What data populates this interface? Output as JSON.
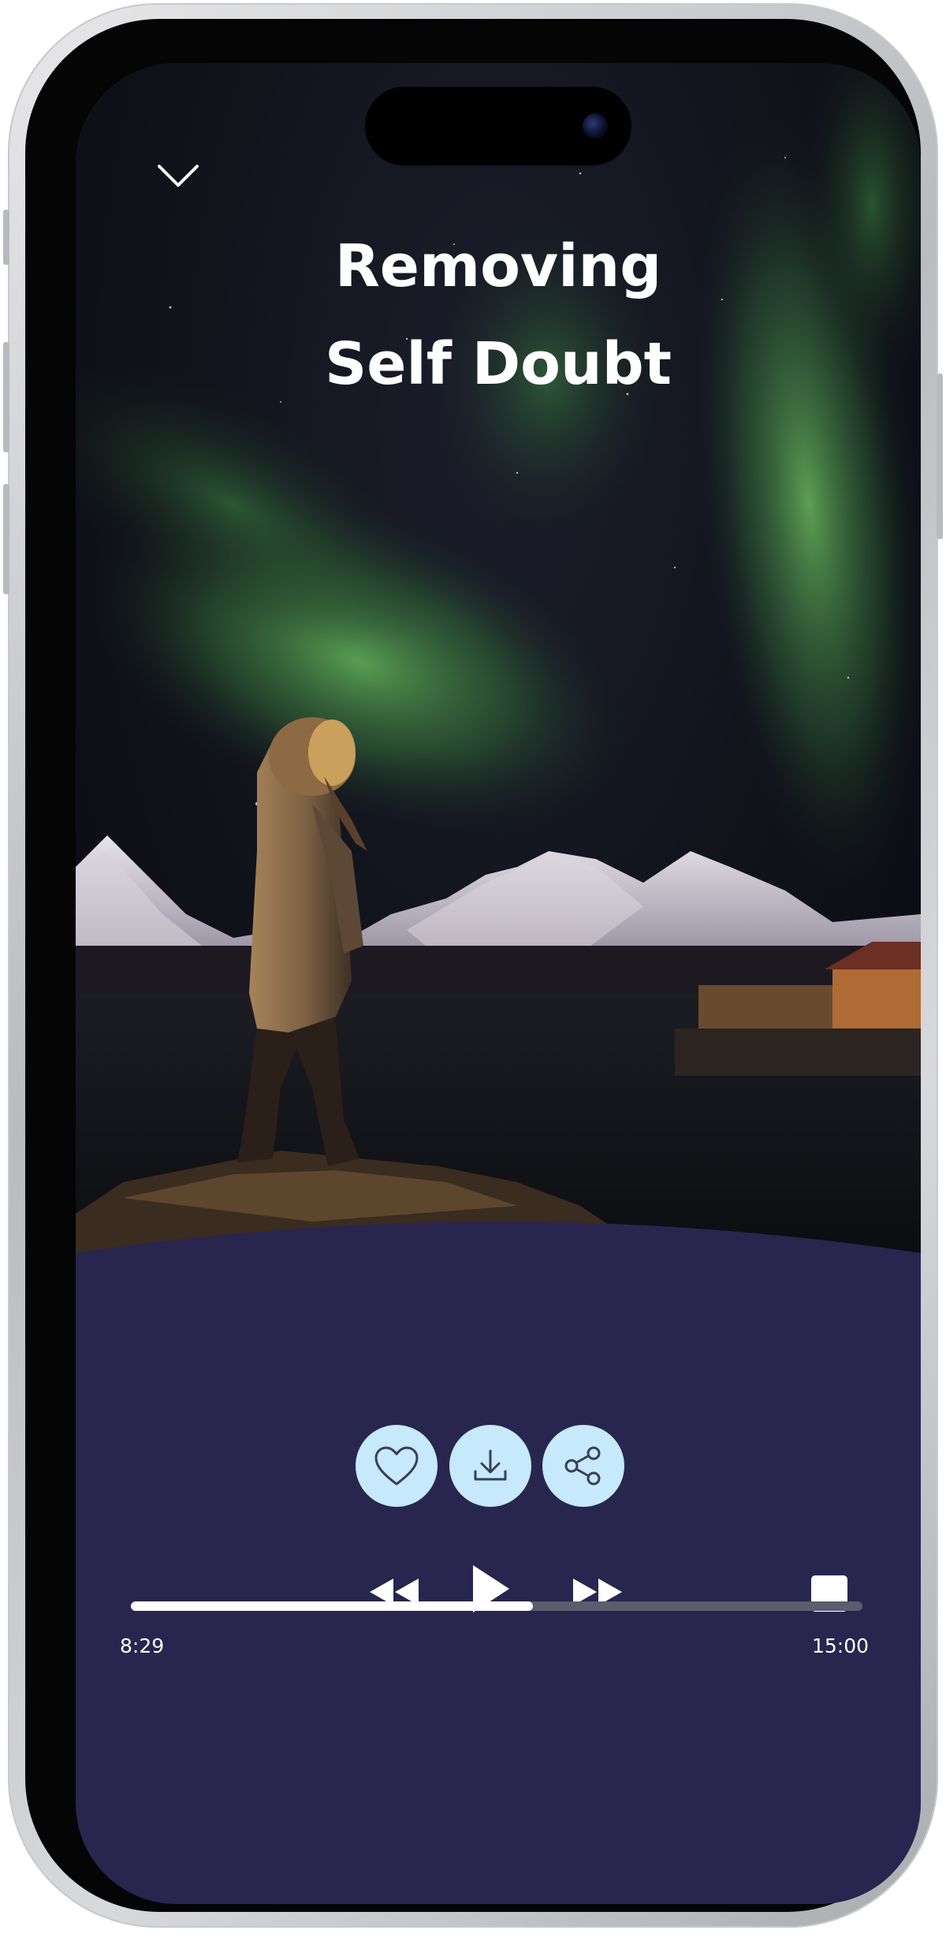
{
  "track": {
    "title": "Removing\nSelf Doubt",
    "elapsed": "8:29",
    "duration": "15:00",
    "progress": 0.55
  },
  "icons": {
    "collapse": "chevron-down-icon",
    "favorite": "heart-icon",
    "download": "download-icon",
    "share": "share-icon",
    "rewind": "rewind-icon",
    "play": "play-icon",
    "fast_forward": "fast-forward-icon",
    "stop": "stop-icon"
  },
  "colors": {
    "panel": "#28264f",
    "action_button": "#c6e9fb",
    "progress_track": "#5d5c6c",
    "progress_fill": "#ffffff",
    "text": "#ffffff"
  }
}
